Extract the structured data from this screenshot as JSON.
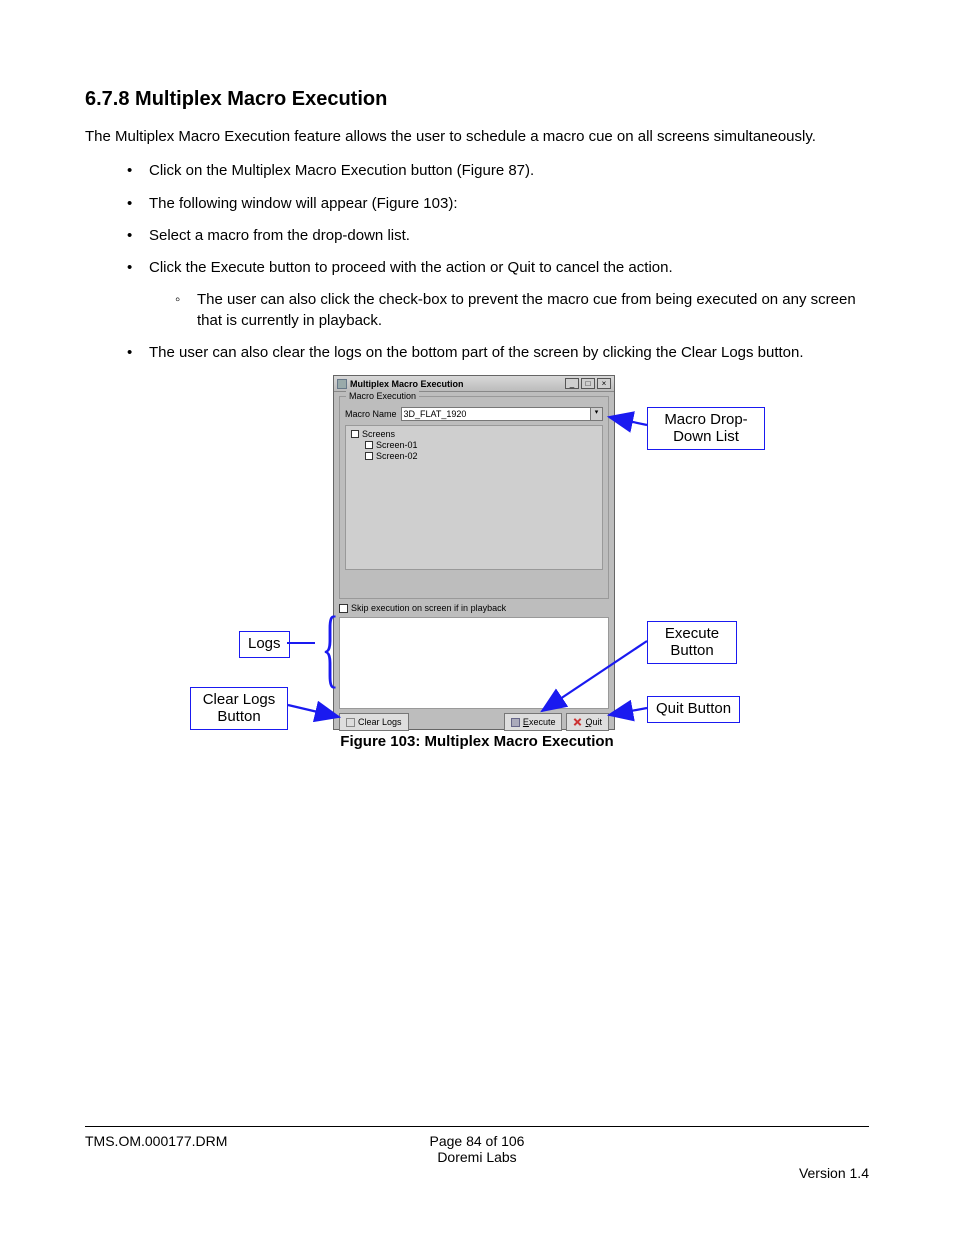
{
  "heading": "6.7.8  Multiplex Macro Execution",
  "intro": "The Multiplex Macro Execution feature allows the user to schedule a macro cue on all screens simultaneously.",
  "bullets": {
    "b1": "Click on the Multiplex Macro Execution button (Figure 87).",
    "b2": "The following window will appear (Figure 103):",
    "b3": "Select a macro from the drop-down list.",
    "b4": "Click the Execute button to proceed with the action or Quit to cancel the action.",
    "b4s1": "The user can also click the check-box to prevent the macro cue from being executed on any screen that is currently in playback.",
    "b5": "The user can also clear the logs on the bottom part of the screen by clicking the Clear Logs button."
  },
  "app": {
    "title": "Multiplex Macro Execution",
    "group_title": "Macro Execution",
    "macro_label": "Macro Name",
    "macro_value": "3D_FLAT_1920",
    "screens_root": "Screens",
    "screen1": "Screen-01",
    "screen2": "Screen-02",
    "skip_label": "Skip execution on screen if in playback",
    "btn_clear": "Clear Logs",
    "btn_execute_pre": "E",
    "btn_execute_suf": "xecute",
    "btn_quit_pre": "Q",
    "btn_quit_suf": "uit",
    "win_min": "_",
    "win_max": "□",
    "win_close": "×"
  },
  "callouts": {
    "macro_dd": "Macro Drop-Down List",
    "logs": "Logs",
    "clear_logs": "Clear Logs Button",
    "execute": "Execute Button",
    "quit": "Quit Button"
  },
  "figure_caption": "Figure 103: Multiplex Macro Execution",
  "footer": {
    "left": "TMS.OM.000177.DRM",
    "center1": "Page 84 of 106",
    "center2": "Doremi Labs",
    "right": "Version 1.4"
  }
}
